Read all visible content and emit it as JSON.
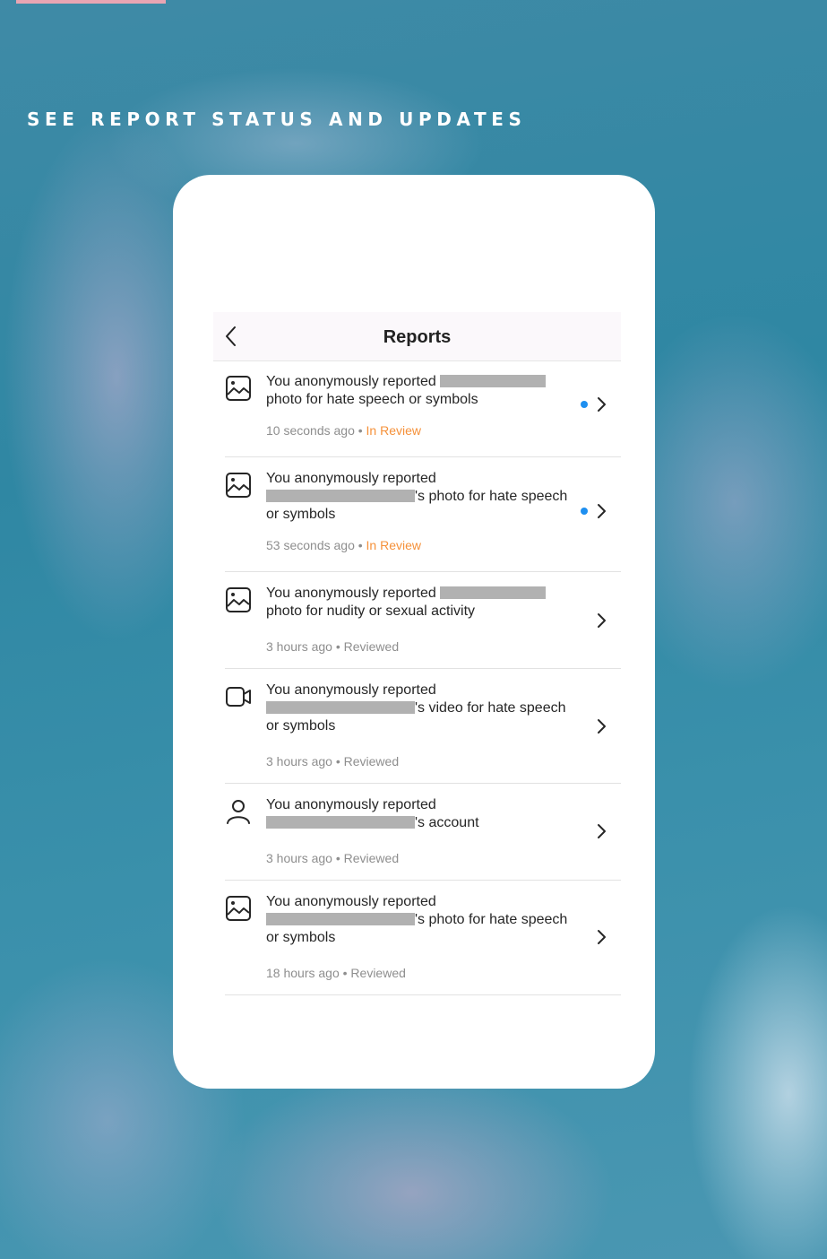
{
  "page": {
    "heading": "SEE REPORT STATUS AND UPDATES"
  },
  "nav": {
    "title": "Reports",
    "back_icon": "chevron-left-icon"
  },
  "colors": {
    "accent_blue": "#1e8ff0",
    "in_review_orange": "#f5913a",
    "reviewed_gray": "#8e8e8e",
    "tab_pink": "#e9a5b3"
  },
  "reports": [
    {
      "icon": "photo-icon",
      "text_before": "You anonymously reported",
      "text_after": "photo for hate speech or symbols",
      "time": "10 seconds ago",
      "separator": "•",
      "status": "In Review",
      "unread": true
    },
    {
      "icon": "photo-icon",
      "text_before": "You anonymously reported",
      "text_after": "'s photo for hate speech or symbols",
      "time": "53 seconds ago",
      "separator": "•",
      "status": "In Review",
      "unread": true
    },
    {
      "icon": "photo-icon",
      "text_before": "You anonymously reported",
      "text_after": "photo for nudity or sexual activity",
      "time": "3 hours ago",
      "separator": "•",
      "status": "Reviewed",
      "unread": false
    },
    {
      "icon": "video-icon",
      "text_before": "You anonymously reported",
      "text_after": "'s video for hate speech or symbols",
      "time": "3 hours ago",
      "separator": "•",
      "status": "Reviewed",
      "unread": false
    },
    {
      "icon": "person-icon",
      "text_before": "You anonymously reported",
      "text_after": "'s account",
      "time": "3 hours ago",
      "separator": "•",
      "status": "Reviewed",
      "unread": false
    },
    {
      "icon": "photo-icon",
      "text_before": "You anonymously reported",
      "text_after": "'s photo for hate speech or symbols",
      "time": "18 hours ago",
      "separator": "•",
      "status": "Reviewed",
      "unread": false
    }
  ]
}
